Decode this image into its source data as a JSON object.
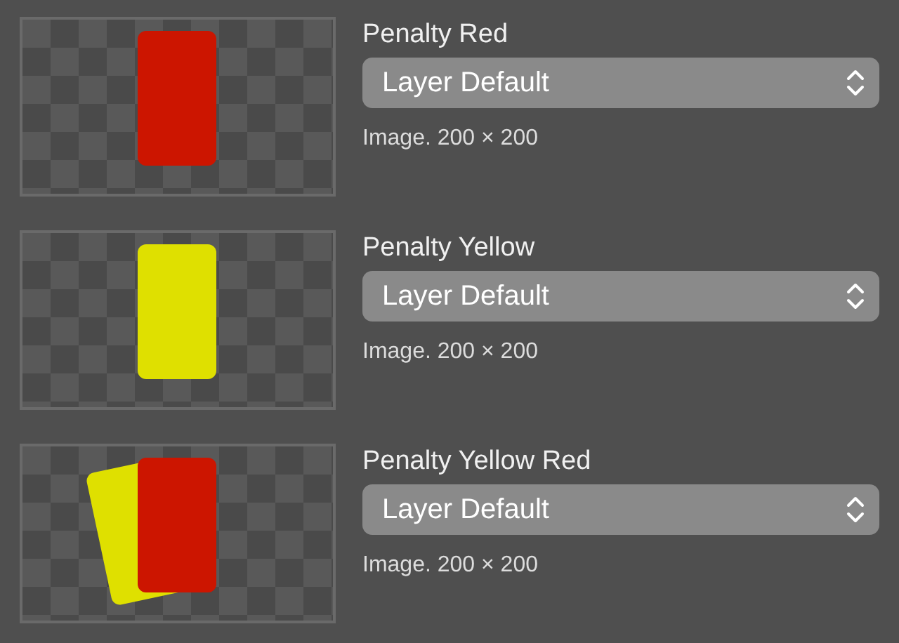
{
  "assets": [
    {
      "name": "Penalty Red",
      "rendering": "Layer Default",
      "info": "Image. 200 × 200",
      "cards": [
        {
          "color": "#cc1500",
          "kind": "upright"
        }
      ]
    },
    {
      "name": "Penalty Yellow",
      "rendering": "Layer Default",
      "info": "Image. 200 × 200",
      "cards": [
        {
          "color": "#dfe000",
          "kind": "upright"
        }
      ]
    },
    {
      "name": "Penalty Yellow Red",
      "rendering": "Layer Default",
      "info": "Image. 200 × 200",
      "cards": [
        {
          "color": "#dfe000",
          "kind": "tilted"
        },
        {
          "color": "#cc1500",
          "kind": "upright"
        }
      ]
    }
  ]
}
